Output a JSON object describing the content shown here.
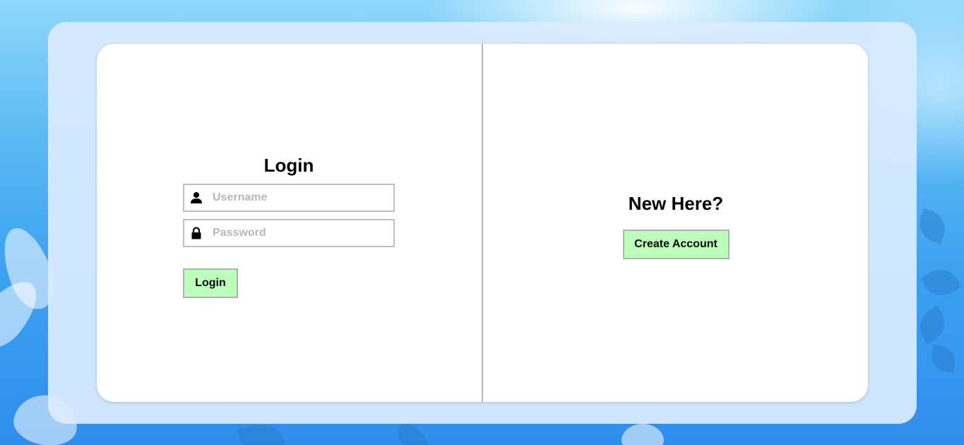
{
  "login": {
    "title": "Login",
    "username": {
      "placeholder": "Username",
      "value": "",
      "icon": "user-icon"
    },
    "password": {
      "placeholder": "Password",
      "value": "",
      "icon": "lock-icon"
    },
    "button_label": "Login"
  },
  "signup": {
    "title": "New Here?",
    "button_label": "Create Account"
  },
  "colors": {
    "button_bg": "#bbffbb",
    "card_bg": "#ffffff",
    "panel_bg": "#dcecfe",
    "background_blue": "#3da2f1"
  }
}
